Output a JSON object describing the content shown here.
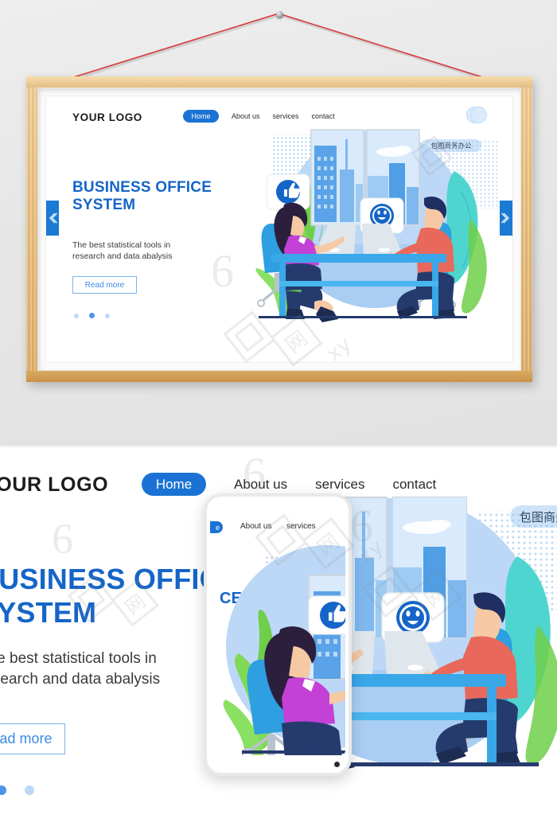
{
  "scene": {
    "description": "Picture-frame mockup preview of a business landing page, with a zoomed detail view and phone mockup below",
    "wall_color": "#e8e8e8",
    "frame_color": "#e8bf80",
    "wire_color": "#d93b3b"
  },
  "landing": {
    "logo": "YOUR LOGO",
    "nav": [
      {
        "label": "Home",
        "active": true
      },
      {
        "label": "About us",
        "active": false
      },
      {
        "label": "services",
        "active": false
      },
      {
        "label": "contact",
        "active": false
      }
    ],
    "title_line1": "BUSINESS OFFICE",
    "title_line2": "SYSTEM",
    "subtitle_line1": "The best statistical tools in",
    "subtitle_line2": "research and data abalysis",
    "cta_label": "Read more",
    "carousel": {
      "count": 3,
      "active_index": 1
    },
    "badge": "包图商务办公",
    "badge_truncated": "包图商务",
    "arrow_prev": "‹",
    "arrow_next": "›",
    "avatar": "profile-circles-icon",
    "colors": {
      "accent": "#1565c8",
      "pill": "#1a73d4",
      "cta_text": "#3d8ae4",
      "cta_border": "#7cb3ef",
      "dot_active": "#4d93e8",
      "dot_idle": "#bcd9f8",
      "badge_bg": "#cfe3f8",
      "arrow_bg": "#1a7ad4"
    }
  },
  "illustration": {
    "name": "two-coworkers-at-desk-illustration",
    "elements": [
      "blue-circle-backdrop",
      "city-window-view",
      "thumbs-up-speech-bubble",
      "smiley-face-speech-bubble",
      "woman-in-purple-shirt",
      "man-in-red-shirt",
      "two-laptops",
      "blue-desk",
      "two-office-chairs",
      "green-leaf-plants",
      "teal-leaf-plant"
    ],
    "colors": {
      "backdrop": "#bcd8f6",
      "desk": "#39a7e8",
      "chair": "#2e9fe0",
      "woman_shirt": "#c341d6",
      "man_shirt": "#e8695c",
      "bubble_blue": "#1565c8",
      "leaf_green": "#6fcf4a",
      "leaf_teal": "#49d3cf"
    }
  },
  "phone_mockup": {
    "name": "smartphone-mockup",
    "nav_visible": [
      "About us",
      "services"
    ],
    "pill_partial": "e",
    "title_partial": "CE"
  },
  "watermark": {
    "text": "包图网",
    "mark": "6"
  }
}
